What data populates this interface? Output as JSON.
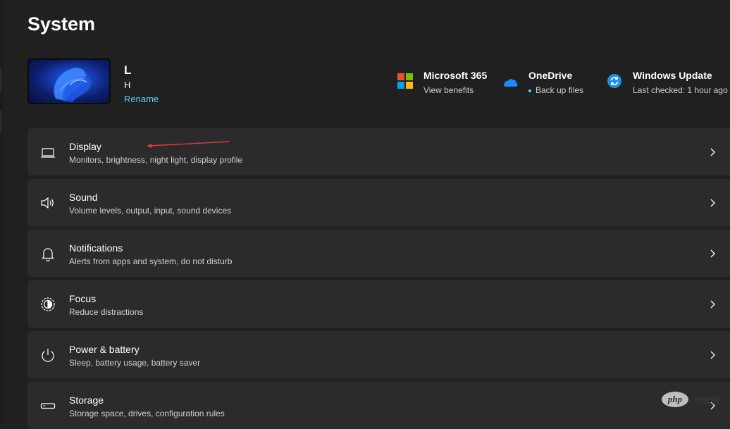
{
  "page": {
    "title": "System"
  },
  "device": {
    "name": "L",
    "subtitle": "H",
    "rename_label": "Rename"
  },
  "quick_links": [
    {
      "title": "Microsoft 365",
      "subtitle": "View benefits",
      "icon": "microsoft-logo-icon"
    },
    {
      "title": "OneDrive",
      "subtitle": "Back up files",
      "icon": "onedrive-cloud-icon"
    },
    {
      "title": "Windows Update",
      "subtitle": "Last checked: 1 hour ago",
      "icon": "windows-update-icon"
    }
  ],
  "settings": [
    {
      "title": "Display",
      "subtitle": "Monitors, brightness, night light, display profile",
      "icon": "display-laptop-icon"
    },
    {
      "title": "Sound",
      "subtitle": "Volume levels, output, input, sound devices",
      "icon": "speaker-icon"
    },
    {
      "title": "Notifications",
      "subtitle": "Alerts from apps and system, do not disturb",
      "icon": "bell-icon"
    },
    {
      "title": "Focus",
      "subtitle": "Reduce distractions",
      "icon": "focus-icon"
    },
    {
      "title": "Power & battery",
      "subtitle": "Sleep, battery usage, battery saver",
      "icon": "power-icon"
    },
    {
      "title": "Storage",
      "subtitle": "Storage space, drives, configuration rules",
      "icon": "storage-drive-icon"
    }
  ],
  "watermark": {
    "text": "php",
    "subtext": "中文网"
  },
  "colors": {
    "background": "#202020",
    "card": "#2b2b2b",
    "accent_link": "#60cdff",
    "annotation_arrow": "#e23b3b"
  }
}
